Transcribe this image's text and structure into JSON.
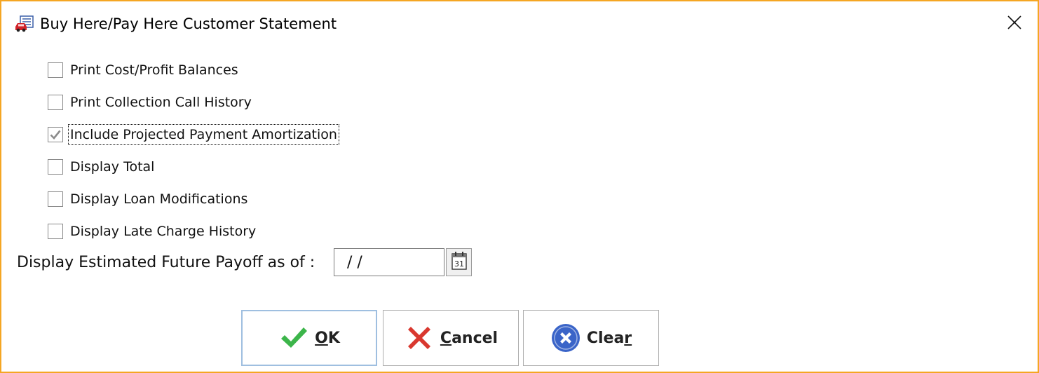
{
  "window": {
    "title": "Buy Here/Pay Here Customer Statement",
    "icon": "statement-car-icon",
    "close_icon": "close-icon",
    "border_color": "#f5a623"
  },
  "options": [
    {
      "label": "Print Cost/Profit Balances",
      "checked": false
    },
    {
      "label": "Print Collection Call History",
      "checked": false
    },
    {
      "label": "Include Projected Payment Amortization",
      "checked": true,
      "focused": true
    },
    {
      "label": "Display Total",
      "checked": false
    },
    {
      "label": "Display Loan Modifications",
      "checked": false
    },
    {
      "label": "Display Late Charge History",
      "checked": false
    }
  ],
  "payoff": {
    "label": "Display Estimated Future Payoff as of :",
    "value": "/ /",
    "calendar_icon": "calendar-icon",
    "calendar_day": "31"
  },
  "buttons": {
    "ok": {
      "mnemonic": "O",
      "rest": "K",
      "icon": "checkmark-icon",
      "color": "#3cb54a"
    },
    "cancel": {
      "mnemonic": "C",
      "rest": "ancel",
      "icon": "cross-icon",
      "color": "#d9382f"
    },
    "clear": {
      "before": "Clea",
      "mnemonic": "r",
      "icon": "clear-circle-icon",
      "color": "#3a64c8"
    }
  }
}
